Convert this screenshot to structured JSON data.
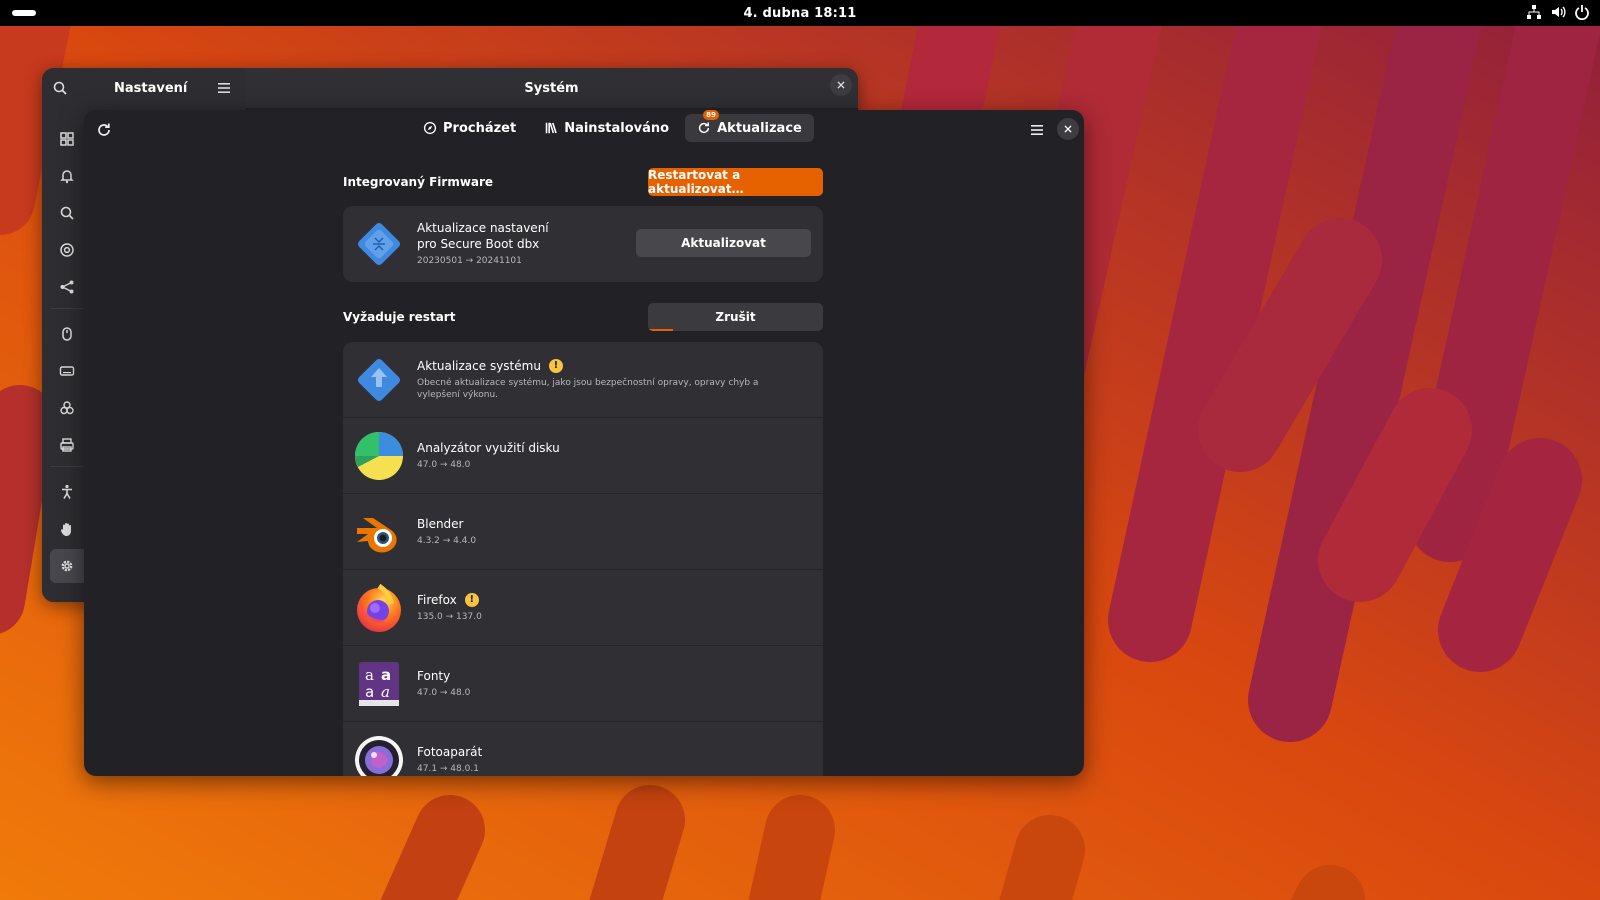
{
  "topbar": {
    "clock": "4. dubna  18:11"
  },
  "settings_window": {
    "sidebar_title": "Nastavení",
    "title": "Systém"
  },
  "software": {
    "tabs": [
      {
        "label": "Procházet",
        "icon": "compass-icon"
      },
      {
        "label": "Nainstalováno",
        "icon": "library-icon"
      },
      {
        "label": "Aktualizace",
        "icon": "refresh-icon",
        "badge": "89"
      }
    ],
    "firmware_section": {
      "title": "Integrovaný Firmware",
      "action": "Restartovat a aktualizovat…",
      "item": {
        "name_line1": "Aktualizace nastavení",
        "name_line2": "pro Secure Boot dbx",
        "version": "20230501 → 20241101",
        "button": "Aktualizovat"
      }
    },
    "restart_section": {
      "title": "Vyžaduje restart",
      "cancel": "Zrušit",
      "progress": 0.14,
      "items": [
        {
          "name": "Aktualizace systému",
          "warning": true,
          "desc": "Obecné aktualizace systému, jako jsou bezpečnostní opravy, opravy chyb a vylepšení výkonu.",
          "icon": "system-update-icon"
        },
        {
          "name": "Analyzátor využití disku",
          "warning": false,
          "desc": "47.0 → 48.0",
          "icon": "disk-usage-icon"
        },
        {
          "name": "Blender",
          "warning": false,
          "desc": "4.3.2 → 4.4.0",
          "icon": "blender-icon"
        },
        {
          "name": "Firefox",
          "warning": true,
          "desc": "135.0 → 137.0",
          "icon": "firefox-icon"
        },
        {
          "name": "Fonty",
          "warning": false,
          "desc": "47.0 → 48.0",
          "icon": "fonts-icon"
        },
        {
          "name": "Fotoaparát",
          "warning": false,
          "desc": "47.1 → 48.0.1",
          "icon": "camera-icon"
        }
      ]
    }
  },
  "colors": {
    "accent": "#e66100",
    "warning": "#f6c343",
    "window_bg": "#222226",
    "card_bg": "#303034"
  }
}
